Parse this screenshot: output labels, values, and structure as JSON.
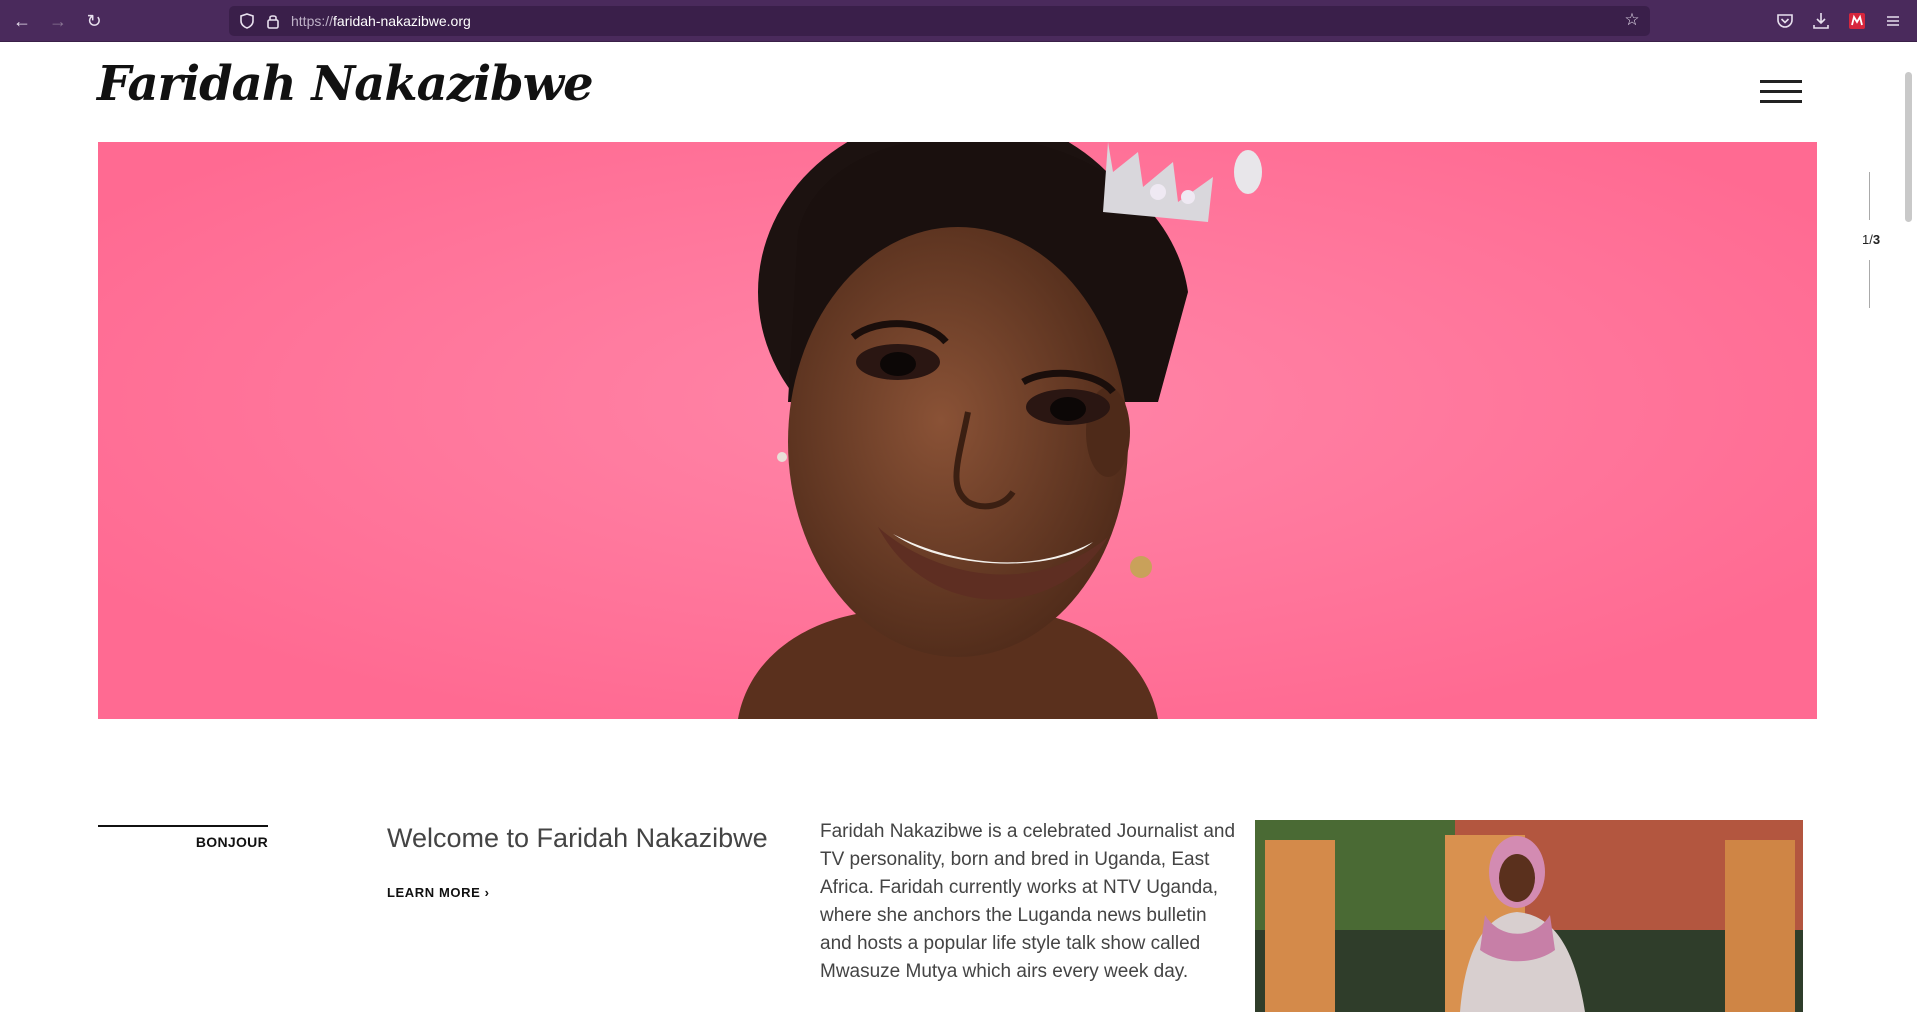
{
  "browser": {
    "url_protocol": "https://",
    "url_domain": "faridah-nakazibwe.org"
  },
  "site": {
    "logo_text": "Faridah  Nakazibwe"
  },
  "slider": {
    "current": "1",
    "separator": "/",
    "total": "3"
  },
  "intro": {
    "section_label": "BONJOUR",
    "welcome_title": "Welcome to Faridah Nakazibwe",
    "learn_more": "LEARN MORE",
    "bio": "Faridah Nakazibwe is a celebrated Journalist and TV personality, born and bred in Uganda, East Africa. Faridah currently works at NTV Uganda, where she anchors the Luganda news bulletin and hosts a popular life style talk show called Mwasuze Mutya which airs every week day."
  },
  "colors": {
    "hero_background": "#ff6f96",
    "browser_toolbar": "#4a2a5c"
  }
}
